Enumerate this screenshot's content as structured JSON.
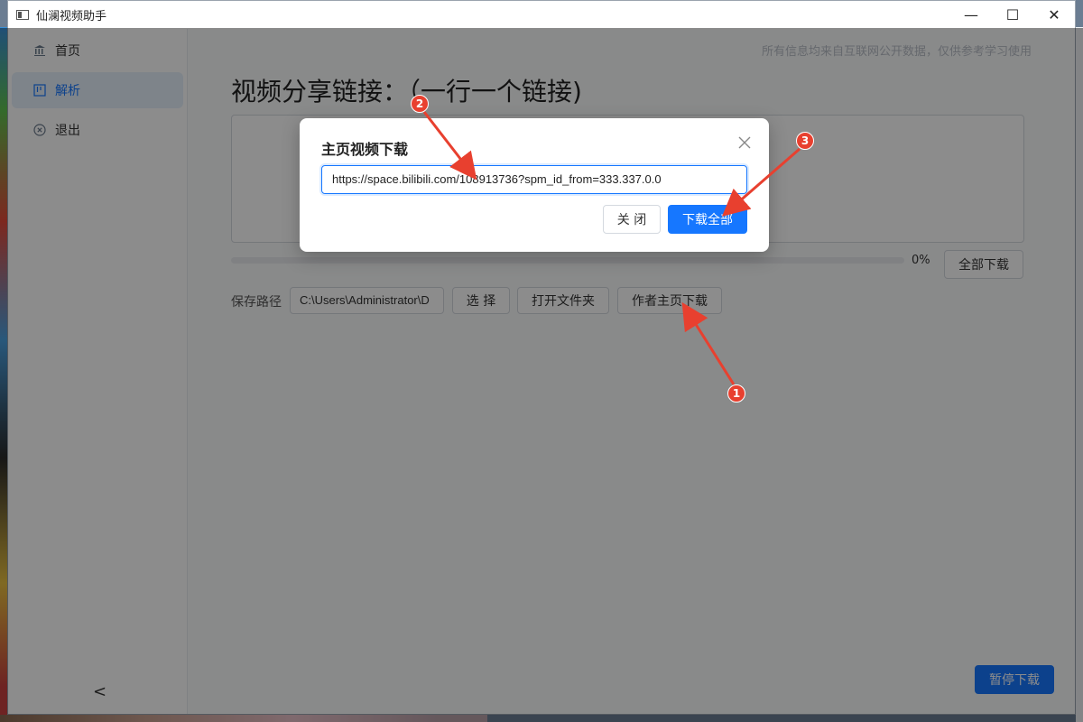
{
  "window": {
    "title": "仙澜视频助手",
    "controls": {
      "minimize": "—",
      "maximize": "☐",
      "close": "✕"
    }
  },
  "sidebar": {
    "items": [
      {
        "label": "首页",
        "icon": "bank-icon",
        "glyph": "🏛"
      },
      {
        "label": "解析",
        "icon": "panel-icon",
        "glyph": "▥",
        "active": true
      },
      {
        "label": "退出",
        "icon": "close-circle-icon",
        "glyph": "⊗"
      }
    ],
    "collapse_glyph": "<"
  },
  "main": {
    "notice": "所有信息均来自互联网公开数据，仅供参考学习使用",
    "heading": "视频分享链接：（一行一个链接)",
    "progress_value": 0,
    "progress_text": "0%",
    "download_all_label": "全部下载",
    "save_path_label": "保存路径",
    "save_path_value": "C:\\Users\\Administrator\\D",
    "choose_label": "选 择",
    "open_folder_label": "打开文件夹",
    "author_home_label": "作者主页下载",
    "pause_label": "暂停下载"
  },
  "modal": {
    "title": "主页视频下载",
    "url_value": "https://space.bilibili.com/108913736?spm_id_from=333.337.0.0",
    "close_label": "关 闭",
    "download_all_label": "下载全部"
  },
  "annotations": {
    "color": "#e8402f",
    "markers": [
      "1",
      "2",
      "3"
    ]
  },
  "colors": {
    "accent": "#1677ff",
    "annotation": "#e8402f"
  }
}
